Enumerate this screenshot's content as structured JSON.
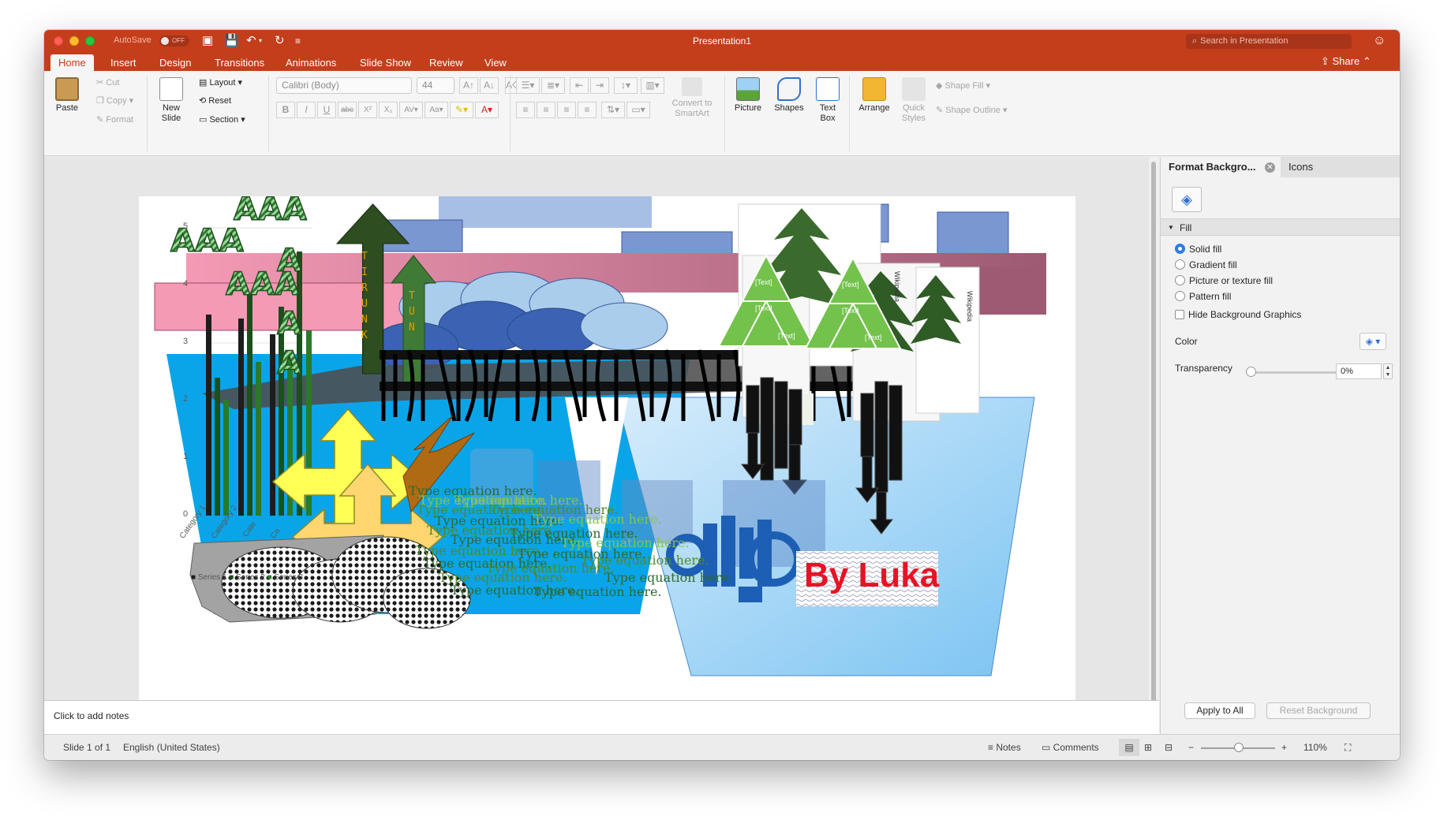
{
  "window": {
    "title": "Presentation1",
    "autosave_label": "AutoSave",
    "autosave_state": "OFF",
    "search_placeholder": "Search in Presentation"
  },
  "ribbon_tabs": [
    "Home",
    "Insert",
    "Design",
    "Transitions",
    "Animations",
    "Slide Show",
    "Review",
    "View"
  ],
  "share_label": "Share",
  "ribbon": {
    "paste": "Paste",
    "cut": "Cut",
    "copy": "Copy",
    "format": "Format",
    "new_slide_1": "New",
    "new_slide_2": "Slide",
    "layout": "Layout",
    "reset": "Reset",
    "section": "Section",
    "font_name": "Calibri (Body)",
    "font_size": "44",
    "convert_1": "Convert to",
    "convert_2": "SmartArt",
    "picture": "Picture",
    "shapes": "Shapes",
    "textbox_1": "Text",
    "textbox_2": "Box",
    "arrange": "Arrange",
    "quick_1": "Quick",
    "quick_2": "Styles",
    "shape_fill": "Shape Fill",
    "shape_outline": "Shape Outline"
  },
  "slide": {
    "chart_y_ticks": [
      "5",
      "4",
      "3",
      "2",
      "1",
      "0"
    ],
    "chart_categories": [
      "Category 1",
      "Category 2",
      "Cate",
      "Ca"
    ],
    "chart_legend": [
      "Series 1",
      "Series 2",
      "Series 3"
    ],
    "smartart_text": [
      "[Text]",
      "[Text]",
      "[Text]",
      "[Text]",
      "[Text]",
      "[Text]"
    ],
    "equation_text": "Type equation here.",
    "signature": "By Luka",
    "wordart": "AAA",
    "arrow_text": "TRIUNK"
  },
  "notes_placeholder": "Click to add notes",
  "pane": {
    "tab_format": "Format Backgro...",
    "tab_icons": "Icons",
    "section": "Fill",
    "options": [
      "Solid fill",
      "Gradient fill",
      "Picture or texture fill",
      "Pattern fill"
    ],
    "hide_bg": "Hide Background Graphics",
    "color_label": "Color",
    "transparency_label": "Transparency",
    "transparency_value": "0%",
    "apply_all": "Apply to All",
    "reset_bg": "Reset Background"
  },
  "status": {
    "slide_count": "Slide 1 of 1",
    "language": "English (United States)",
    "notes": "Notes",
    "comments": "Comments",
    "zoom": "110%"
  },
  "colors": {
    "accent": "#c43e1c",
    "selection": "#2f7ce8"
  }
}
